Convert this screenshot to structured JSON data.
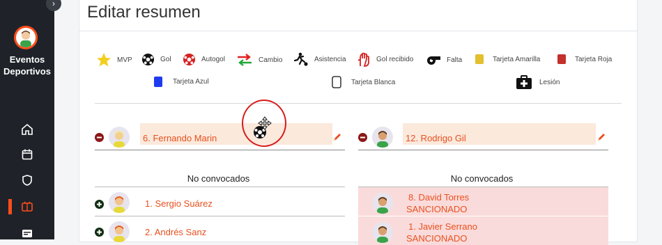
{
  "app": {
    "name_line1": "Eventos",
    "name_line2": "Deportivos"
  },
  "page": {
    "title": "Editar resumen"
  },
  "legend": {
    "mvp": "MVP",
    "gol": "Gol",
    "autogol": "Autogol",
    "cambio": "Cambio",
    "asistencia": "Asistencia",
    "gol_recibido": "Gol recibido",
    "falta": "Falta",
    "tarjeta_amarilla": "Tarjeta Amarilla",
    "tarjeta_roja": "Tarjeta Roja",
    "tarjeta_azul": "Tarjeta Azul",
    "tarjeta_blanca": "Tarjeta Blanca",
    "lesion": "Lesión"
  },
  "colors": {
    "accent": "#ff4d1c",
    "name_text": "#e8501e",
    "name_bg": "#fbe9dc",
    "sanctioned_bg": "#fadbdb"
  },
  "left_team": {
    "starter": {
      "name": "6. Fernando Marin"
    },
    "section": "No convocados",
    "players": [
      {
        "name": "1. Sergio Suárez"
      },
      {
        "name": "2. Andrés Sanz"
      }
    ]
  },
  "right_team": {
    "starter": {
      "name": "12. Rodrigo Gil"
    },
    "section": "No convocados",
    "players": [
      {
        "name": "8. David Torres",
        "status": "SANCIONADO"
      },
      {
        "name": "1. Javier Serrano",
        "status": "SANCIONADO"
      }
    ]
  }
}
